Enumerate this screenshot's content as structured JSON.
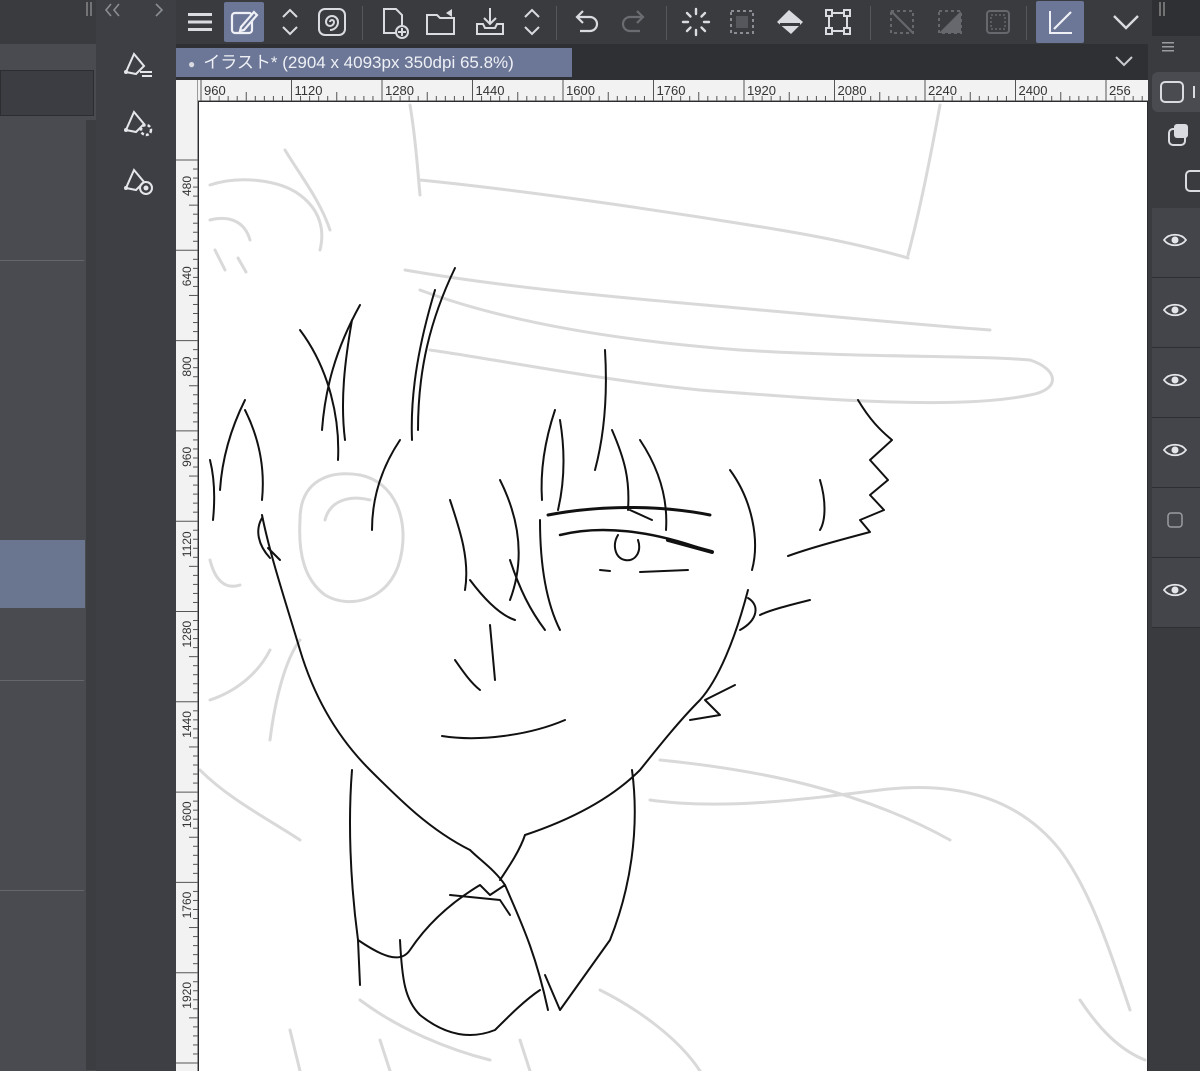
{
  "document": {
    "tab_title": "イラスト* (2904 x 4093px 350dpi 65.8%)"
  },
  "ruler_top": [
    "960",
    "1120",
    "1280",
    "1440",
    "1600",
    "1760",
    "1920",
    "2080",
    "2240",
    "2400",
    "256"
  ],
  "ruler_left": [
    "480",
    "640",
    "800",
    "960",
    "1120",
    "1280",
    "1440",
    "1600",
    "1760",
    "1920",
    "80"
  ],
  "toolbar": {
    "icons": [
      "menu-icon",
      "pen-edit-icon",
      "updown-icon",
      "spiral-icon",
      "new-canvas-icon",
      "open-folder-icon",
      "save-import-icon",
      "updown-icon",
      "undo-icon",
      "redo-icon",
      "loading-icon",
      "selection-dashed-icon",
      "fill-bucket-icon",
      "transform-icon",
      "clear-selection-icon",
      "invert-selection-icon",
      "selection-outline-icon",
      "ruler-snap-icon",
      "chevron-down-icon"
    ]
  },
  "accent_color": "#6c7797",
  "layers": [
    {
      "visible": true
    },
    {
      "visible": true
    },
    {
      "visible": true
    },
    {
      "visible": true
    },
    {
      "visible": false
    },
    {
      "visible": true
    }
  ]
}
